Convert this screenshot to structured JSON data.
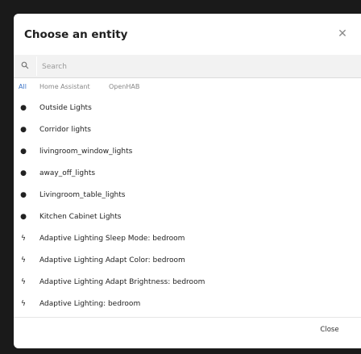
{
  "dialog": {
    "title": "Choose an entity",
    "close_icon": "close-icon",
    "search": {
      "placeholder": "Search",
      "value": ""
    },
    "tabs": [
      {
        "label": "All",
        "active": true
      },
      {
        "label": "Home Assistant",
        "active": false
      },
      {
        "label": "OpenHAB",
        "active": false
      }
    ],
    "items": [
      {
        "label": "Outside Lights",
        "icon": "lightbulb-icon"
      },
      {
        "label": "Corridor lights",
        "icon": "lightbulb-icon"
      },
      {
        "label": "livingroom_window_lights",
        "icon": "lightbulb-icon"
      },
      {
        "label": "away_off_lights",
        "icon": "lightbulb-icon"
      },
      {
        "label": "Livingroom_table_lights",
        "icon": "lightbulb-icon"
      },
      {
        "label": "Kitchen Cabinet Lights",
        "icon": "lightbulb-icon"
      },
      {
        "label": "Adaptive Lighting Sleep Mode: bedroom",
        "icon": "lightning-icon"
      },
      {
        "label": "Adaptive Lighting Adapt Color: bedroom",
        "icon": "lightning-icon"
      },
      {
        "label": "Adaptive Lighting Adapt Brightness: bedroom",
        "icon": "lightning-icon"
      },
      {
        "label": "Adaptive Lighting: bedroom",
        "icon": "lightning-icon"
      }
    ],
    "close_label": "Close"
  },
  "colors": {
    "accent": "#3b73c7",
    "backdrop": "#1c1c1c"
  }
}
